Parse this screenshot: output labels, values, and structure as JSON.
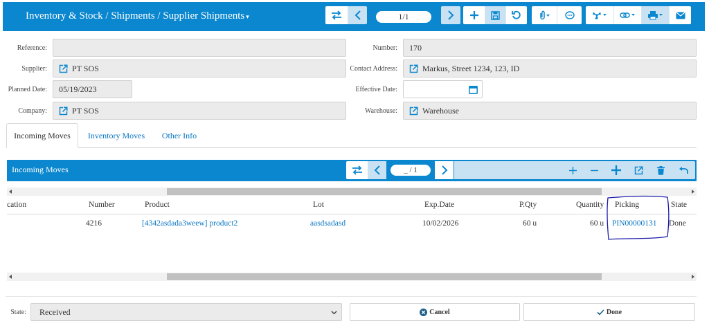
{
  "header": {
    "title": "Inventory & Stock / Shipments / Supplier Shipments",
    "pager": "1/1",
    "icons": [
      "swap-icon",
      "chevron-left-icon",
      "chevron-right-icon",
      "plus-icon",
      "save-icon",
      "undo-icon",
      "paperclip-icon",
      "comment-icon",
      "fan-icon",
      "link-icon",
      "print-icon",
      "mail-icon"
    ]
  },
  "form": {
    "reference": {
      "label": "Reference:",
      "value": ""
    },
    "number": {
      "label": "Number:",
      "value": "170"
    },
    "supplier": {
      "label": "Supplier:",
      "value": "PT SOS"
    },
    "contact_address": {
      "label": "Contact Address:",
      "value": "Markus, Street 1234, 123, ID"
    },
    "planned_date": {
      "label": "Planned Date:",
      "value": "05/19/2023"
    },
    "effective_date": {
      "label": "Effective Date:",
      "value": ""
    },
    "company": {
      "label": "Company:",
      "value": "PT SOS"
    },
    "warehouse": {
      "label": "Warehouse:",
      "value": "Warehouse"
    }
  },
  "tabs": [
    {
      "label": "Incoming Moves",
      "active": true
    },
    {
      "label": "Inventory Moves",
      "active": false
    },
    {
      "label": "Other Info",
      "active": false
    }
  ],
  "grid": {
    "title": "Incoming Moves",
    "pager": "_ / 1",
    "columns": [
      "cation",
      "Number",
      "Product",
      "Lot",
      "Exp.Date",
      "P.Qty",
      "Quantity",
      "Picking",
      "State"
    ],
    "rows": [
      {
        "number": "4216",
        "product": "[4342asdada3weew] product2",
        "lot": "aasdsadasd",
        "exp_date": "10/02/2026",
        "p_qty": "60  u",
        "quantity": "60  u",
        "picking": "PIN00000131",
        "state": "Done"
      }
    ]
  },
  "footer": {
    "state_label": "State:",
    "state_value": "Received",
    "cancel_label": "Cancel",
    "done_label": "Done"
  },
  "colors": {
    "primary": "#0a87cf",
    "link": "#0a76c4",
    "annotation": "#1a1aa8"
  }
}
